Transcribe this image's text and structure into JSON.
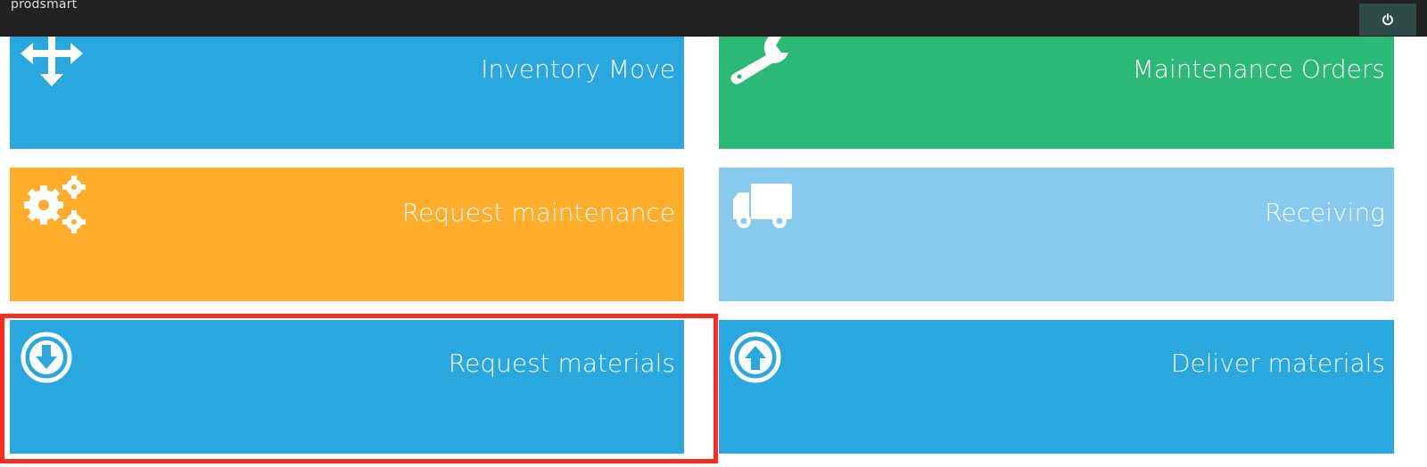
{
  "app": {
    "brand": "prodsmart"
  },
  "header": {
    "power_icon": "power-icon"
  },
  "tiles": [
    {
      "label": "Inventory Move",
      "icon": "arrows-move-icon",
      "color": "#29a8e0"
    },
    {
      "label": "Maintenance Orders",
      "icon": "wrench-icon",
      "color": "#2bb978"
    },
    {
      "label": "Request maintenance",
      "icon": "gears-icon",
      "color": "#ffad2b"
    },
    {
      "label": "Receiving",
      "icon": "truck-icon",
      "color": "#88caee"
    },
    {
      "label": "Request materials",
      "icon": "arrow-circle-down-icon",
      "color": "#29a8e0"
    },
    {
      "label": "Deliver materials",
      "icon": "arrow-circle-up-icon",
      "color": "#29a8e0"
    }
  ],
  "highlight": {
    "color": "#ff2a1a",
    "target": "Request materials"
  }
}
